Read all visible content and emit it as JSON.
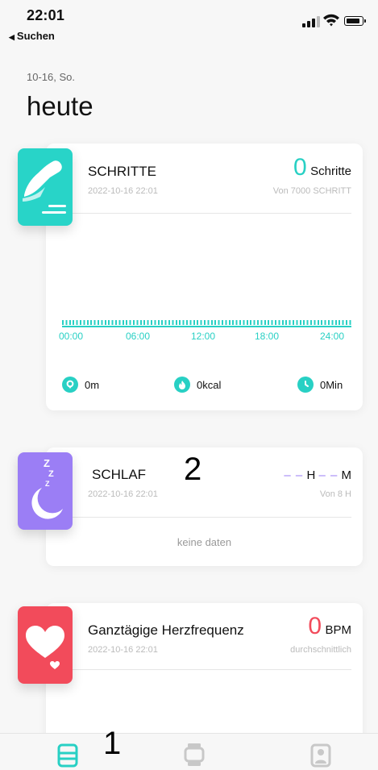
{
  "status_bar": {
    "time": "22:01",
    "back_label": "Suchen"
  },
  "header": {
    "date": "10-16, So.",
    "title": "heute"
  },
  "steps_card": {
    "title": "SCHRITTE",
    "timestamp": "2022-10-16 22:01",
    "value": "0",
    "unit": "Schritte",
    "goal": "Von 7000 SCHRITT",
    "x_labels": [
      "00:00",
      "06:00",
      "12:00",
      "18:00",
      "24:00"
    ],
    "stats": [
      {
        "icon": "location-pin-icon",
        "value": "0m"
      },
      {
        "icon": "flame-icon",
        "value": "0kcal"
      },
      {
        "icon": "clock-icon",
        "value": "0Min"
      }
    ],
    "color": "#28d0c4"
  },
  "sleep_card": {
    "title": "SCHLAF",
    "timestamp": "2022-10-16 22:01",
    "hours": "– –",
    "hours_unit": "H",
    "minutes": "– –",
    "minutes_unit": "M",
    "goal": "Von 8 H",
    "empty": "keine daten",
    "color": "#9b7ef5"
  },
  "heart_card": {
    "title": "Ganztägige Herzfrequenz",
    "timestamp": "2022-10-16 22:01",
    "value": "0",
    "unit": "BPM",
    "sub": "durchschnittlich",
    "color": "#f24b5b"
  },
  "annotations": {
    "one": "1",
    "two": "2"
  },
  "tabbar": {
    "tabs": [
      {
        "icon": "today-icon",
        "active": true
      },
      {
        "icon": "watch-icon",
        "active": false
      },
      {
        "icon": "profile-icon",
        "active": false
      }
    ],
    "active_color": "#28d0c4",
    "inactive_color": "#c8c8c8"
  }
}
